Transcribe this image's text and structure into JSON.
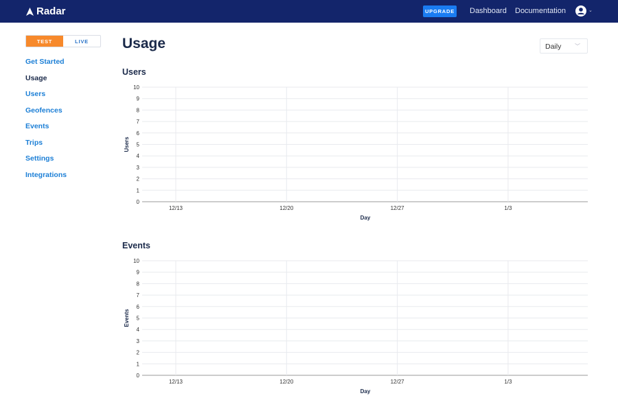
{
  "nav": {
    "brand": "Radar",
    "upgrade": "UPGRADE",
    "links": [
      "Dashboard",
      "Documentation"
    ]
  },
  "env_toggle": {
    "test": "TEST",
    "live": "LIVE",
    "selected": "TEST"
  },
  "sidebar": {
    "items": [
      {
        "label": "Get Started"
      },
      {
        "label": "Usage",
        "active": true
      },
      {
        "label": "Users"
      },
      {
        "label": "Geofences"
      },
      {
        "label": "Events"
      },
      {
        "label": "Trips"
      },
      {
        "label": "Settings"
      },
      {
        "label": "Integrations"
      }
    ]
  },
  "page": {
    "title": "Usage",
    "interval": "Daily"
  },
  "chart_data": [
    {
      "type": "line",
      "title": "Users",
      "xlabel": "Day",
      "ylabel": "Users",
      "ylim": [
        0,
        10
      ],
      "yticks": [
        0,
        1,
        2,
        3,
        4,
        5,
        6,
        7,
        8,
        9,
        10
      ],
      "xticks": [
        "12/13",
        "12/20",
        "12/27",
        "1/3"
      ],
      "series": [],
      "grid": true
    },
    {
      "type": "line",
      "title": "Events",
      "xlabel": "Day",
      "ylabel": "Events",
      "ylim": [
        0,
        10
      ],
      "yticks": [
        0,
        1,
        2,
        3,
        4,
        5,
        6,
        7,
        8,
        9,
        10
      ],
      "xticks": [
        "12/13",
        "12/20",
        "12/27",
        "1/3"
      ],
      "series": [],
      "grid": true
    }
  ]
}
